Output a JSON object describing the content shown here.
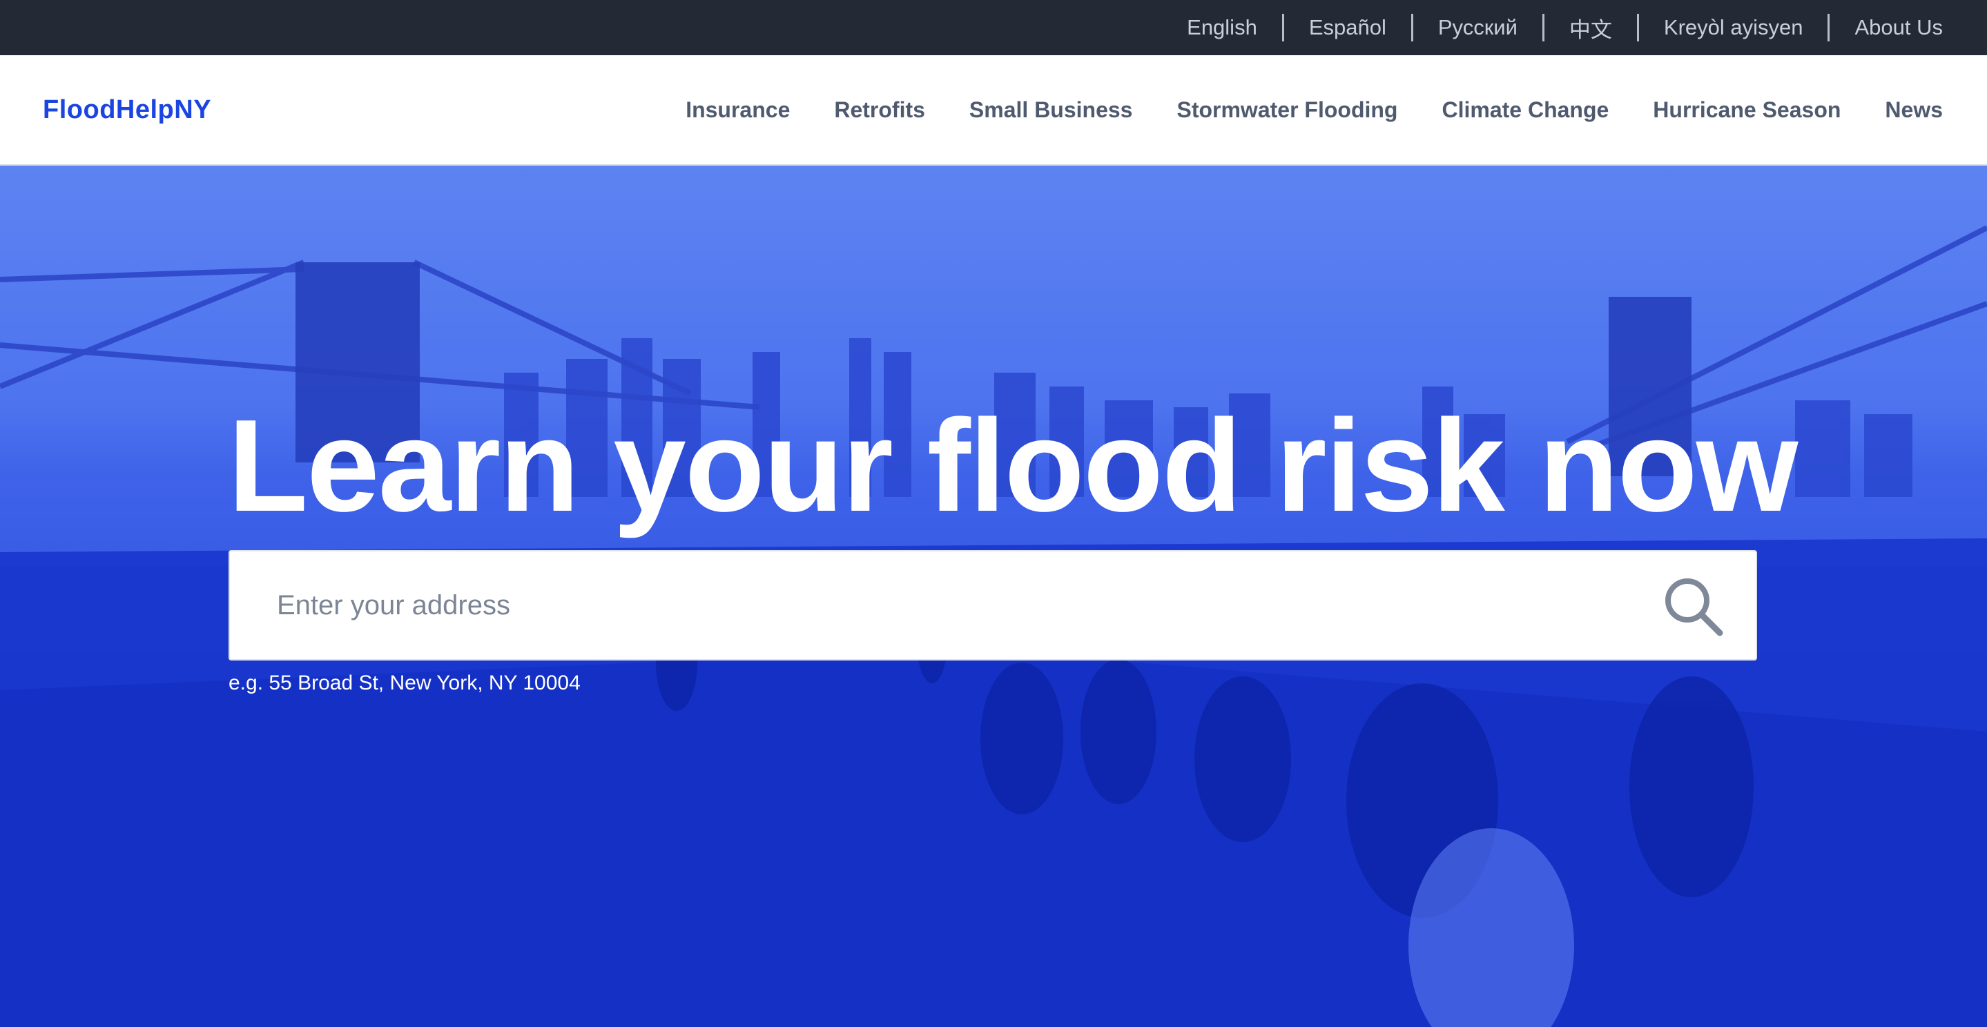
{
  "languages": [
    {
      "label": "English"
    },
    {
      "label": "Español"
    },
    {
      "label": "Русский"
    },
    {
      "label": "中文"
    },
    {
      "label": "Kreyòl ayisyen"
    },
    {
      "label": "About Us"
    }
  ],
  "brand": {
    "name": "FloodHelpNY",
    "color": "#1b45e0"
  },
  "nav": {
    "items": [
      {
        "label": "Insurance"
      },
      {
        "label": "Retrofits"
      },
      {
        "label": "Small Business"
      },
      {
        "label": "Stormwater Flooding"
      },
      {
        "label": "Climate Change"
      },
      {
        "label": "Hurricane Season"
      },
      {
        "label": "News"
      }
    ]
  },
  "hero": {
    "title": "Learn your flood risk now",
    "search": {
      "placeholder": "Enter your address",
      "value": "",
      "icon": "search-icon"
    },
    "example": "e.g. 55 Broad St, New York, NY 10004",
    "overlay_color": "#1f3fe0"
  },
  "colors": {
    "topbar_bg": "#232a36",
    "nav_text": "#4f5a6e",
    "accent": "#1b45e0"
  }
}
